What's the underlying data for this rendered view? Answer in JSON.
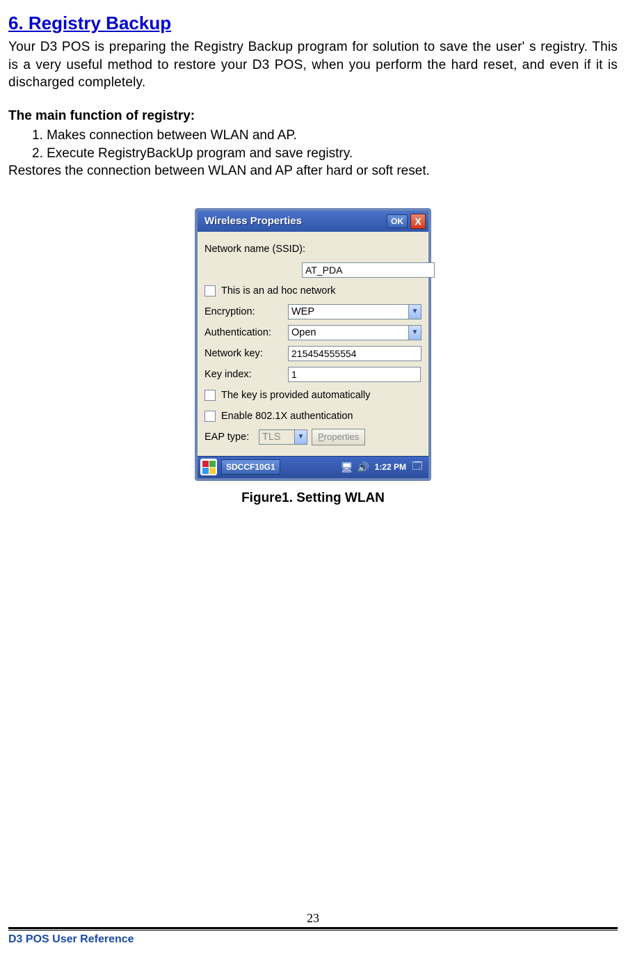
{
  "section": {
    "title": "6. Registry Backup",
    "intro": "Your D3 POS is preparing the Registry Backup program for solution to save the user' s registry. This is a very useful method to restore your D3 POS, when you perform the hard reset, and even if it is discharged completely.",
    "subhead": "The main function of registry:",
    "items": [
      "1. Makes connection between WLAN and AP.",
      "2. Execute RegistryBackUp program and save registry."
    ],
    "restore": "Restores the connection between WLAN and AP after hard or soft reset."
  },
  "dialog": {
    "title": "Wireless Properties",
    "ok": "OK",
    "close": "X",
    "ssid_label": "Network name (SSID):",
    "ssid_value": "AT_PDA",
    "adhoc_label": "This is an ad hoc network",
    "encryption_label": "Encryption:",
    "encryption_value": "WEP",
    "auth_label": "Authentication:",
    "auth_value": "Open",
    "key_label": "Network key:",
    "key_value": "215454555554",
    "keyindex_label": "Key index:",
    "keyindex_value": "1",
    "autokey_label": "The key is provided automatically",
    "eap_auth_label": "Enable 802.1X authentication",
    "eap_type_label": "EAP type:",
    "eap_type_value": "TLS",
    "properties_btn": "Properties"
  },
  "taskbar": {
    "app": "SDCCF10G1",
    "clock": "1:22 PM"
  },
  "figure_caption": "Figure1. Setting WLAN",
  "footer": {
    "page": "23",
    "ref": "D3 POS User Reference"
  }
}
